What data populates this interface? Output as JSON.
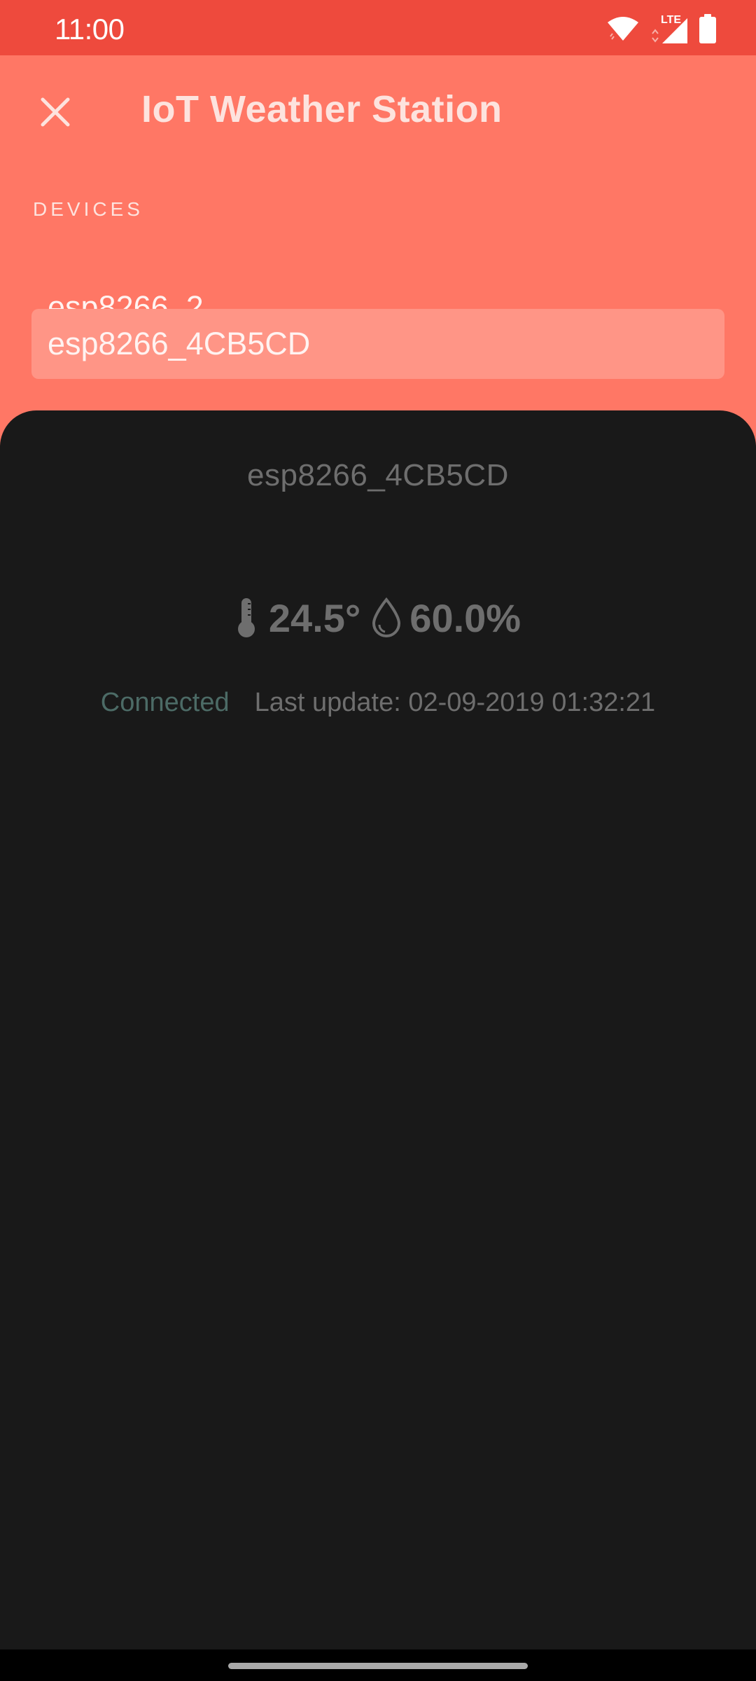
{
  "status_bar": {
    "time": "11:00",
    "network_label": "LTE",
    "icons": [
      "wifi-icon",
      "lte-signal-icon",
      "battery-icon"
    ]
  },
  "header": {
    "title": "IoT Weather Station",
    "close_icon": "close-icon"
  },
  "devices": {
    "section_label": "DEVICES",
    "items": [
      {
        "label": "esp8266_2",
        "selected": false
      },
      {
        "label": "esp8266_4CB5CD",
        "selected": true
      }
    ]
  },
  "detail": {
    "device_name": "esp8266_4CB5CD",
    "temperature": "24.5°",
    "humidity": "60.0%",
    "connection_status": "Connected",
    "last_update": "Last update: 02-09-2019 01:32:21"
  },
  "colors": {
    "header_background": "#ff7765",
    "status_bar_background": "#ee4a3d",
    "selected_item_background": "#ff9586",
    "sheet_background": "#191919",
    "connected_color": "#4c6b66"
  }
}
